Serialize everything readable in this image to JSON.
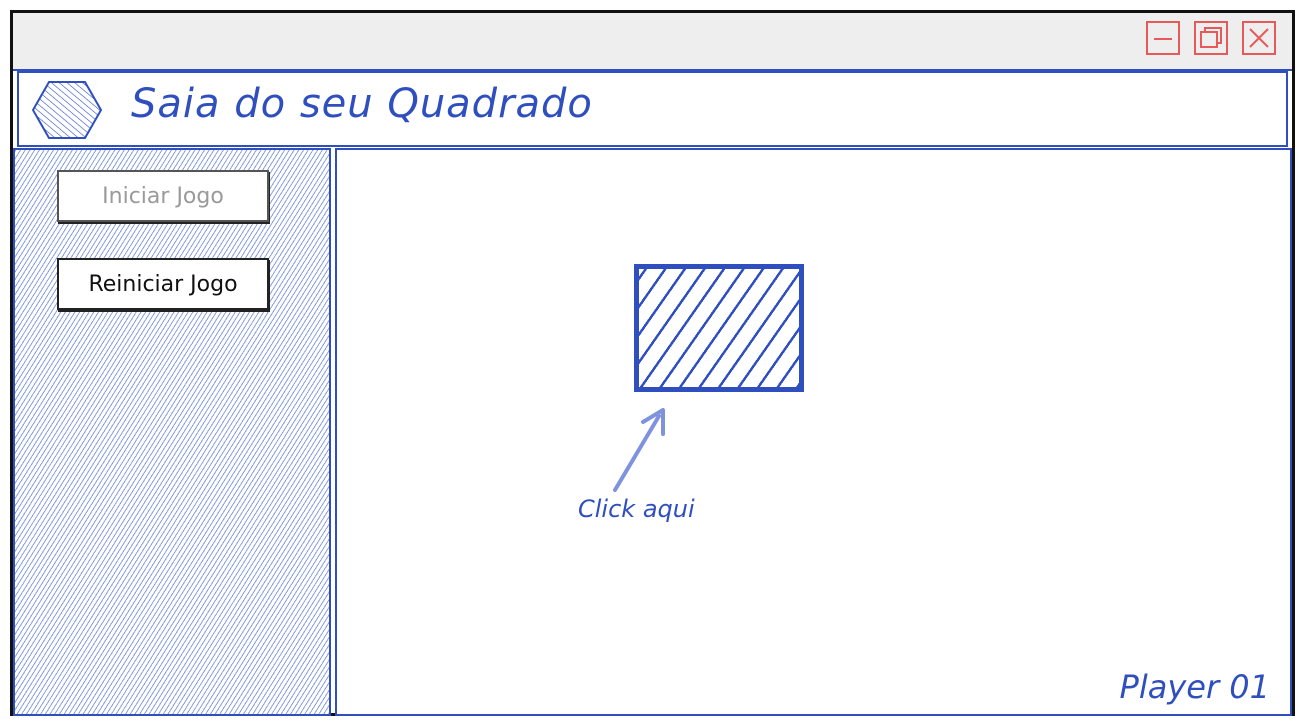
{
  "window": {
    "controls": {
      "minimize_icon": "minimize-icon",
      "maximize_icon": "maximize-icon",
      "close_icon": "close-icon",
      "color": "#e85a5a"
    }
  },
  "header": {
    "logo_icon": "hexagon-logo-icon",
    "title": "Saia do seu Quadrado",
    "accent": "#2f4fbf"
  },
  "sidebar": {
    "start_button": "Iniciar Jogo",
    "start_button_state": "disabled",
    "restart_button": "Reiniciar Jogo"
  },
  "game": {
    "hint_text": "Click aqui",
    "hint_icon": "arrow-up-right-icon",
    "player_label": "Player 01"
  }
}
